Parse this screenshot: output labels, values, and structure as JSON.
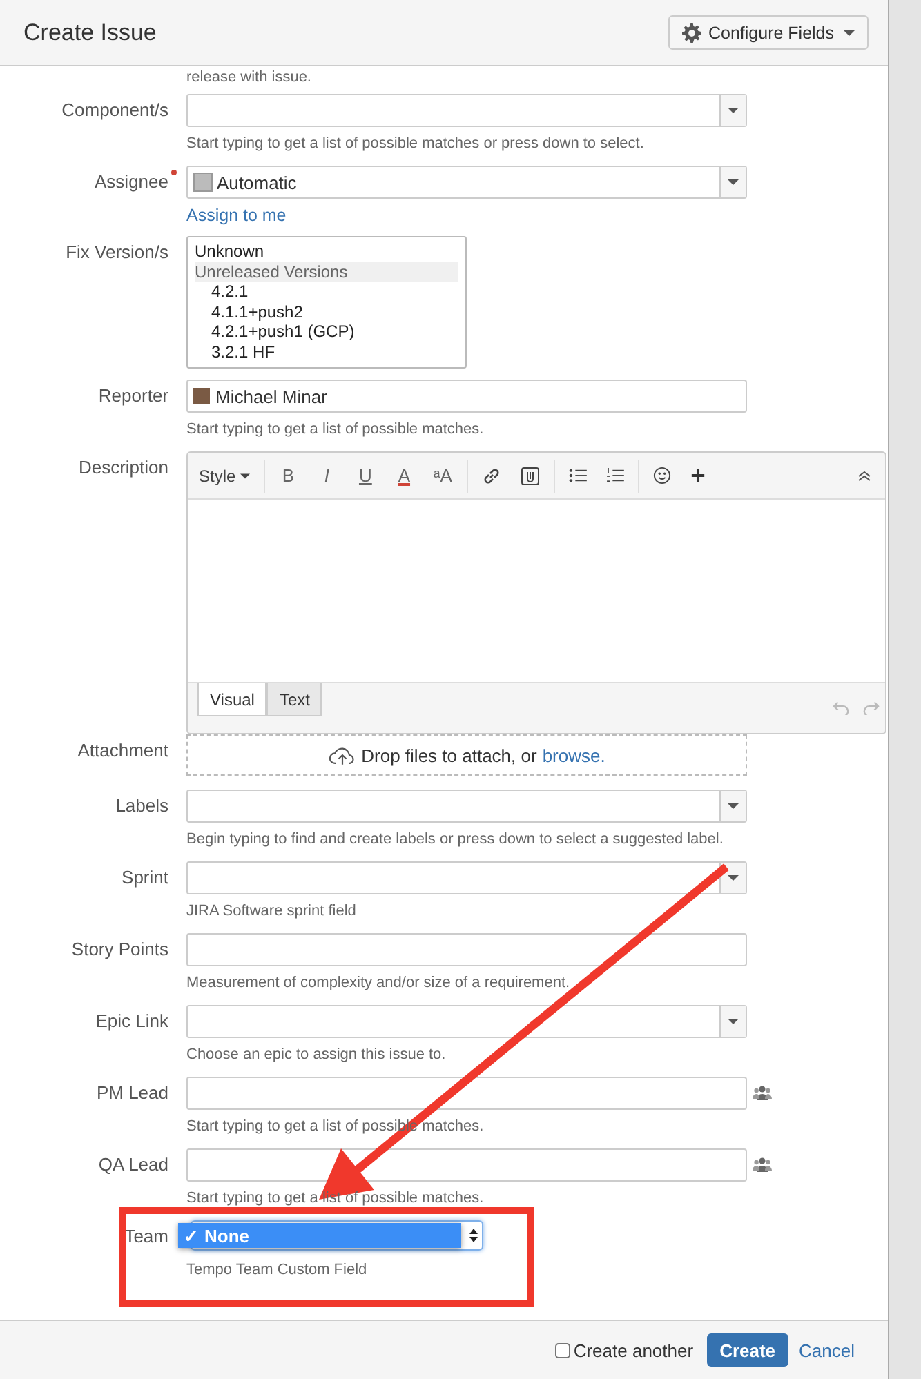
{
  "dialog": {
    "title": "Create Issue",
    "configure_button": "Configure Fields"
  },
  "top_hint": "release with issue.",
  "fields": [
    {
      "kind": "select",
      "label": "Component/s",
      "hint": "Start typing to get a list of possible matches or press down to select."
    },
    {
      "kind": "select",
      "label": "Assignee",
      "required": true,
      "value": "Automatic",
      "link": "Assign to me"
    },
    {
      "kind": "listbox",
      "label": "Fix Version/s",
      "options": [
        {
          "text": "Unknown"
        },
        {
          "text": "Unreleased Versions",
          "children": [
            {
              "text": "4.2.1"
            },
            {
              "text": "4.1.1+push2"
            },
            {
              "text": "4.2.1+push1 (GCP)"
            },
            {
              "text": "3.2.1 HF"
            }
          ]
        }
      ]
    },
    {
      "kind": "user",
      "label": "Reporter",
      "value": "Michael Minar",
      "hint": "Start typing to get a list of possible matches."
    },
    {
      "kind": "editor",
      "label": "Description",
      "style_label": "Style",
      "format_buttons": [
        "B",
        "I",
        "U",
        "A",
        "ᵃA"
      ],
      "tabs": [
        {
          "label": "Visual",
          "selected": true
        },
        {
          "label": "Text",
          "selected": false
        }
      ]
    },
    {
      "kind": "attachment",
      "label": "Attachment",
      "text": "Drop files to attach, or",
      "link": "browse."
    },
    {
      "kind": "select",
      "label": "Labels",
      "hint": "Begin typing to find and create labels or press down to select a suggested label."
    },
    {
      "kind": "select",
      "label": "Sprint",
      "hint": "JIRA Software sprint field"
    },
    {
      "kind": "text",
      "label": "Story Points",
      "hint": "Measurement of complexity and/or size of a requirement."
    },
    {
      "kind": "select",
      "label": "Epic Link",
      "hint": "Choose an epic to assign this issue to."
    },
    {
      "kind": "people",
      "label": "PM Lead",
      "hint": "Start typing to get a list of possible matches."
    },
    {
      "kind": "people",
      "label": "QA Lead",
      "hint": "Start typing to get a list of possible matches."
    },
    {
      "kind": "dropdown",
      "label": "Team",
      "check": "✓",
      "value": "None",
      "hint": "Tempo Team Custom Field"
    }
  ],
  "footer": {
    "create_another": {
      "label": "Create another",
      "checked": false
    },
    "create_button": "Create",
    "cancel_link": "Cancel"
  }
}
